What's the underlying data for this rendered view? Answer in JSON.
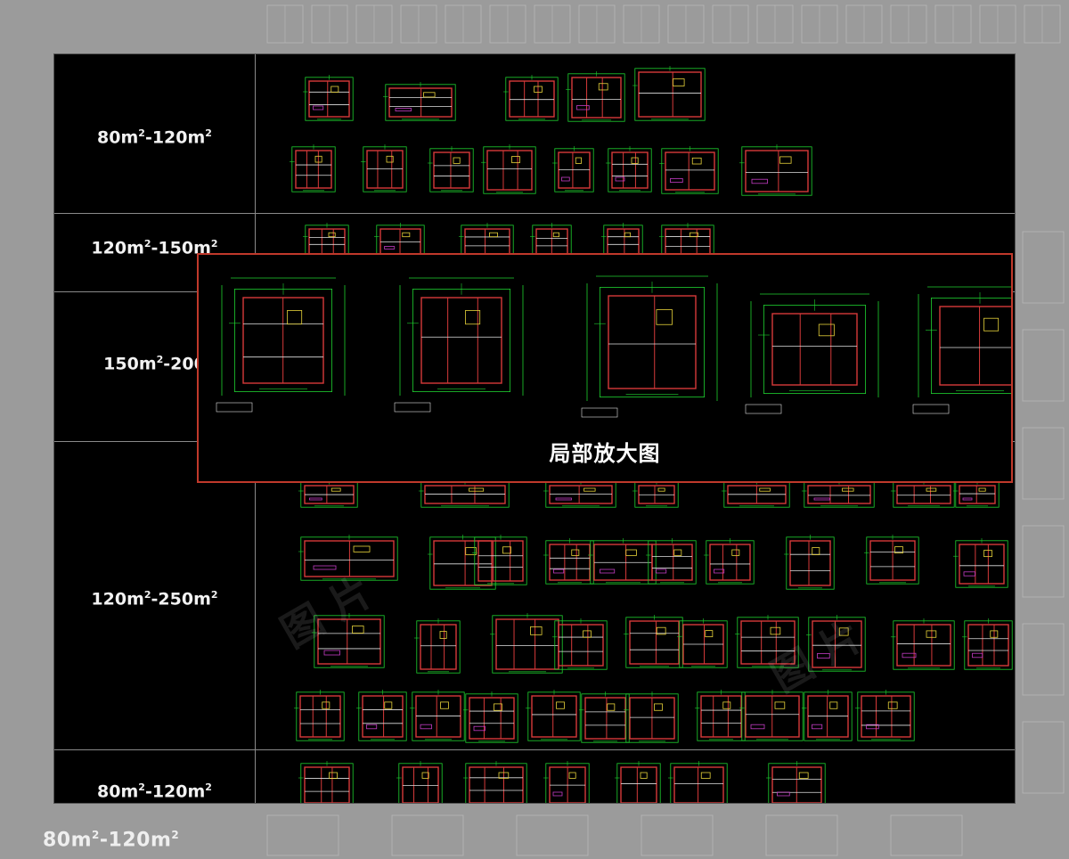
{
  "rows": [
    {
      "label": "80m",
      "sup1": "2",
      "mid": "-120m",
      "sup2": "2"
    },
    {
      "label": "120m",
      "sup1": "2",
      "mid": "-150m",
      "sup2": "2"
    },
    {
      "label": "150m",
      "sup1": "2",
      "mid": "-200",
      "sup2": ""
    },
    {
      "label": "120m",
      "sup1": "2",
      "mid": "-250m",
      "sup2": "2"
    },
    {
      "label": "80m",
      "sup1": "2",
      "mid": "-120m",
      "sup2": "2"
    }
  ],
  "zoom_panel": {
    "title": "局部放大图"
  },
  "background_label": {
    "label": "80m",
    "sup1": "2",
    "mid": "-120m",
    "sup2": "2"
  },
  "colors": {
    "canvas": "#000000",
    "frame": "#c0392b",
    "line_green": "#1fd12f",
    "line_red": "#d63a3a",
    "line_yellow": "#e6d23a",
    "line_white": "#e0e0e0",
    "line_magenta": "#c43cc4"
  }
}
